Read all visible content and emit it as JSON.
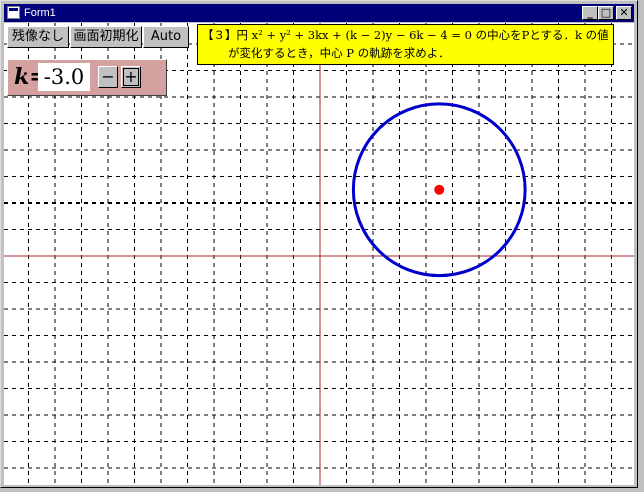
{
  "window": {
    "title": "Form1"
  },
  "titlebar_buttons": {
    "minimize": "_",
    "maximize": "□",
    "close": "✕"
  },
  "toolbar": {
    "no_trace_label": "残像なし",
    "reset_label": "画面初期化",
    "auto_label": "Auto"
  },
  "problem": {
    "line1": "【３】円 x² + y² + 3kx + (k − 2)y − 6k − 4 = 0 の中心をPとする．k の値",
    "line2": "が変化するとき，中心 P の軌跡を求めよ．"
  },
  "kcontrol": {
    "label": "k=",
    "value": "-3.0",
    "minus_label": "−",
    "plus_label": "+"
  },
  "colors": {
    "axis": "#a52a2a",
    "grid": "#000000",
    "circle": "#0000cd",
    "center": "#ff0000",
    "panel": "#d4a0a0",
    "problem_bg": "#ffff00",
    "titlebar": "#00007b"
  },
  "graph": {
    "k": -3.0,
    "center": [
      4.5,
      2.5
    ],
    "radius": 3.24
  }
}
